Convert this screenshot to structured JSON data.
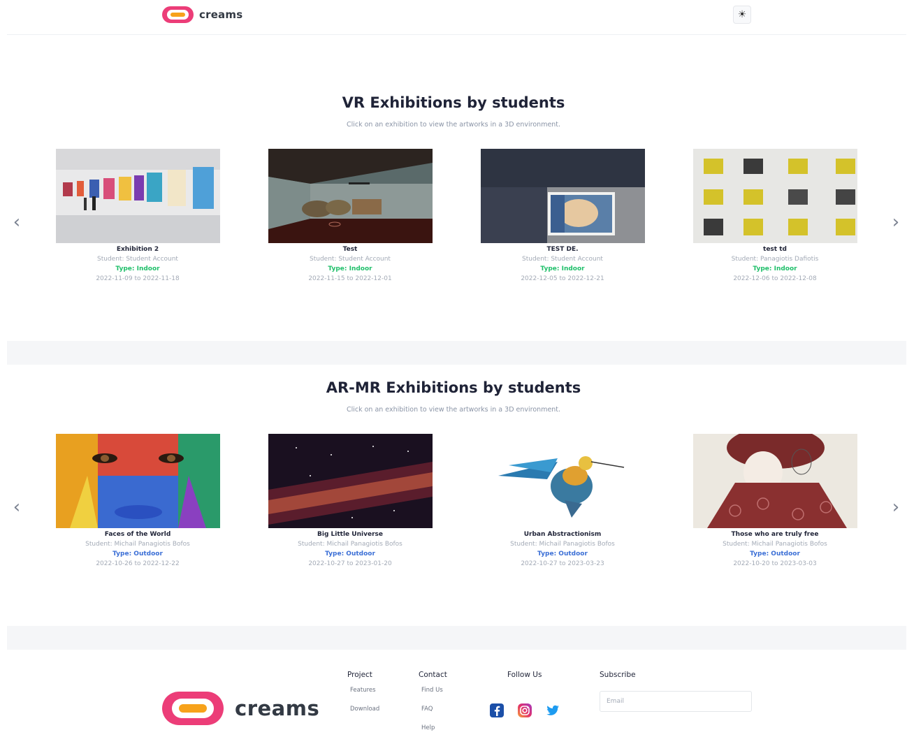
{
  "header": {
    "brand": "creams",
    "theme_toggle_icon": "sun-icon"
  },
  "vr_section": {
    "title": "VR Exhibitions by students",
    "subtitle": "Click on an exhibition to view the artworks in a 3D environment.",
    "cards": [
      {
        "name": "Exhibition 2",
        "student": "Student: Student Account",
        "type": "Type: Indoor",
        "dates": "2022-11-09 to 2022-11-18"
      },
      {
        "name": "Test",
        "student": "Student: Student Account",
        "type": "Type: Indoor",
        "dates": "2022-11-15 to 2022-12-01"
      },
      {
        "name": "TEST DE.",
        "student": "Student: Student Account",
        "type": "Type: Indoor",
        "dates": "2022-12-05 to 2022-12-21"
      },
      {
        "name": "test td",
        "student": "Student: Panagiotis Dafiotis",
        "type": "Type: Indoor",
        "dates": "2022-12-06 to 2022-12-08"
      }
    ]
  },
  "ar_section": {
    "title": "AR-MR Exhibitions by students",
    "subtitle": "Click on an exhibition to view the artworks in a 3D environment.",
    "cards": [
      {
        "name": "Faces of the World",
        "student": "Student: Michail Panagiotis Bofos",
        "type": "Type: Outdoor",
        "dates": "2022-10-26 to 2022-12-22"
      },
      {
        "name": "Big Little Universe",
        "student": "Student: Michail Panagiotis Bofos",
        "type": "Type: Outdoor",
        "dates": "2022-10-27 to 2023-01-20"
      },
      {
        "name": "Urban Abstractionism",
        "student": "Student: Michail Panagiotis Bofos",
        "type": "Type: Outdoor",
        "dates": "2022-10-27 to 2023-03-23"
      },
      {
        "name": "Those who are truly free",
        "student": "Student: Michail Panagiotis Bofos",
        "type": "Type: Outdoor",
        "dates": "2022-10-20 to 2023-03-03"
      }
    ]
  },
  "footer": {
    "brand": "creams",
    "project": {
      "title": "Project",
      "links": [
        "Features",
        "Download"
      ]
    },
    "contact": {
      "title": "Contact",
      "links": [
        "Find Us",
        "FAQ",
        "Help"
      ]
    },
    "follow": {
      "title": "Follow Us",
      "icons": [
        "facebook-icon",
        "instagram-icon",
        "twitter-icon"
      ]
    },
    "subscribe": {
      "title": "Subscribe",
      "placeholder": "Email"
    }
  },
  "colors": {
    "indoor": "#1fbf6a",
    "outdoor": "#3b6fd6",
    "brand_pink": "#ec3d78",
    "brand_orange": "#f7a21b"
  }
}
